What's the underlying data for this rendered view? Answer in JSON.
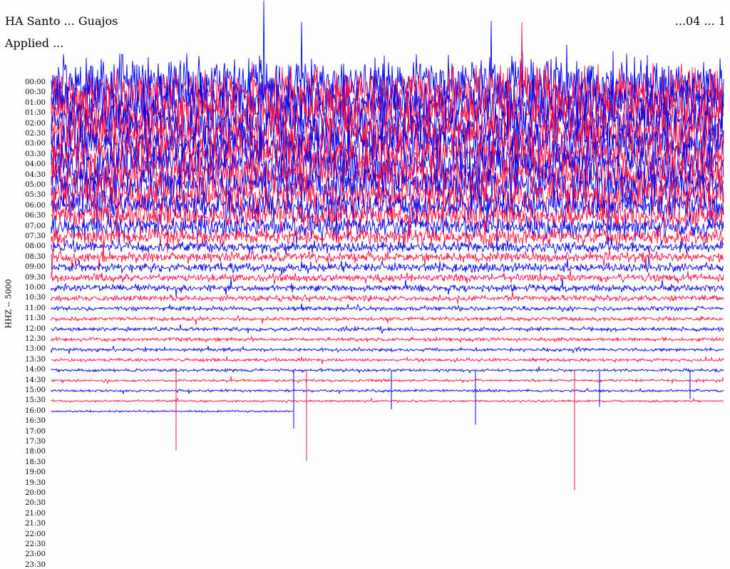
{
  "header": {
    "title": "HA Santo ... Guajos",
    "applied": "Applied ...",
    "date": "...04 ... 1"
  },
  "colors": {
    "trace_a": "#0000ee",
    "trace_b": "#ff1040",
    "background": "#fefefe"
  },
  "chart_data": {
    "type": "line",
    "title": "",
    "ylabel": "HHZ -- 5000",
    "ytick_labels": [
      "00:00",
      "00:30",
      "01:00",
      "01:30",
      "02:00",
      "02:30",
      "03:00",
      "03:30",
      "04:00",
      "04:30",
      "05:00",
      "05:30",
      "06:00",
      "06:30",
      "07:00",
      "07:30",
      "08:00",
      "08:30",
      "09:00",
      "09:30",
      "10:00",
      "10:30",
      "11:00",
      "11:30",
      "12:00",
      "12:30",
      "13:00",
      "13:30",
      "14:00",
      "14:30",
      "15:00",
      "15:30",
      "16:00",
      "16:30",
      "17:00",
      "17:30",
      "18:00",
      "18:30",
      "19:00",
      "19:30",
      "20:00",
      "20:30",
      "21:00",
      "21:30",
      "22:00",
      "22:30",
      "23:00",
      "23:30"
    ],
    "last_trace_time": "16:00",
    "last_trace_fraction": 0.36,
    "series_colors": [
      "#0000ee",
      "#ff1040"
    ],
    "grid": false,
    "legend": "none"
  }
}
